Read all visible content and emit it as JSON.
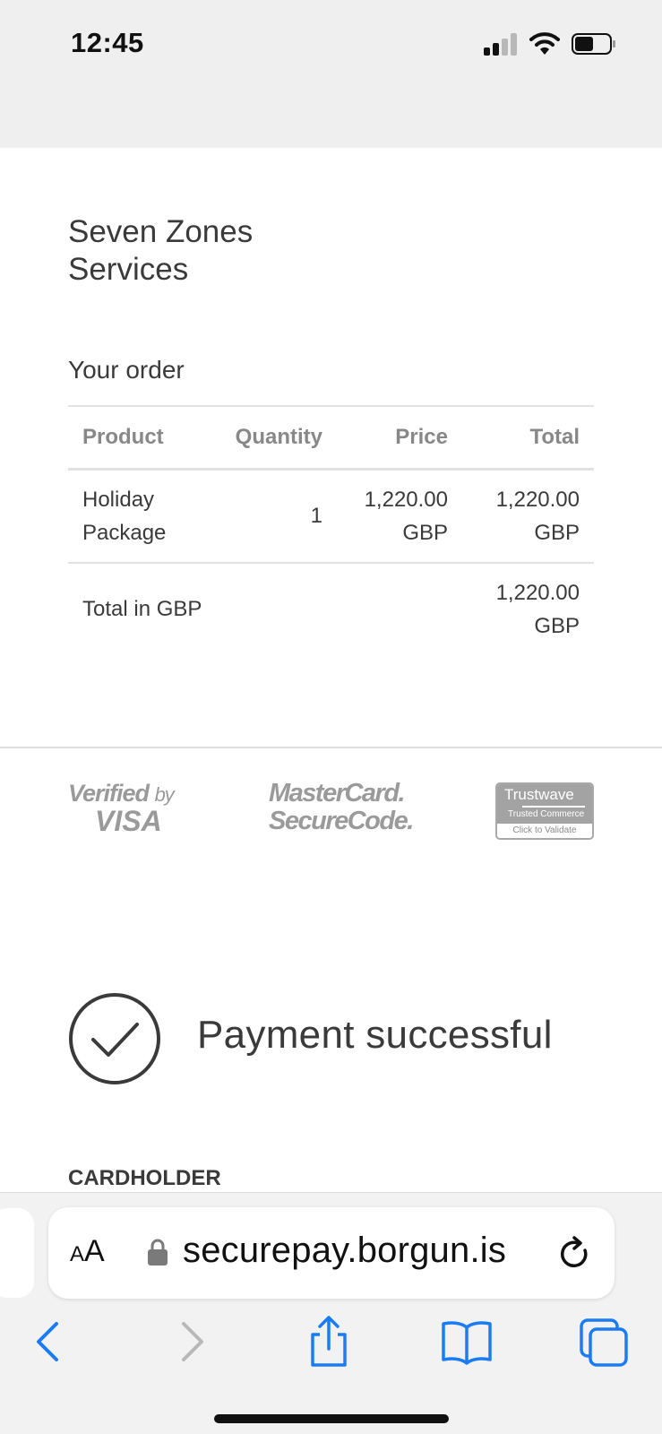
{
  "status_bar": {
    "time": "12:45"
  },
  "merchant": {
    "name": "Seven Zones Services"
  },
  "order": {
    "heading": "Your order",
    "columns": [
      "Product",
      "Quantity",
      "Price",
      "Total"
    ],
    "items": [
      {
        "product": "Holiday Package",
        "quantity": "1",
        "price": "1,220.00 GBP",
        "total": "1,220.00 GBP"
      }
    ],
    "total_label": "Total in GBP",
    "total_value": "1,220.00 GBP"
  },
  "trust_logos": {
    "visa": {
      "line1": "Verified",
      "line1_small": "by",
      "line2": "VISA"
    },
    "mastercard": {
      "line1": "MasterCard.",
      "line2": "SecureCode."
    },
    "trustwave": {
      "brand": "Trustwave",
      "sub": "Trusted Commerce",
      "action": "Click to Validate"
    }
  },
  "payment": {
    "status": "Payment successful"
  },
  "cardholder": {
    "label": "CARDHOLDER"
  },
  "browser": {
    "aa_small": "A",
    "aa_big": "A",
    "url": "securepay.borgun.is"
  },
  "colors": {
    "accent": "#1a7cf5",
    "text": "#3a3a3a",
    "muted": "#888888"
  }
}
